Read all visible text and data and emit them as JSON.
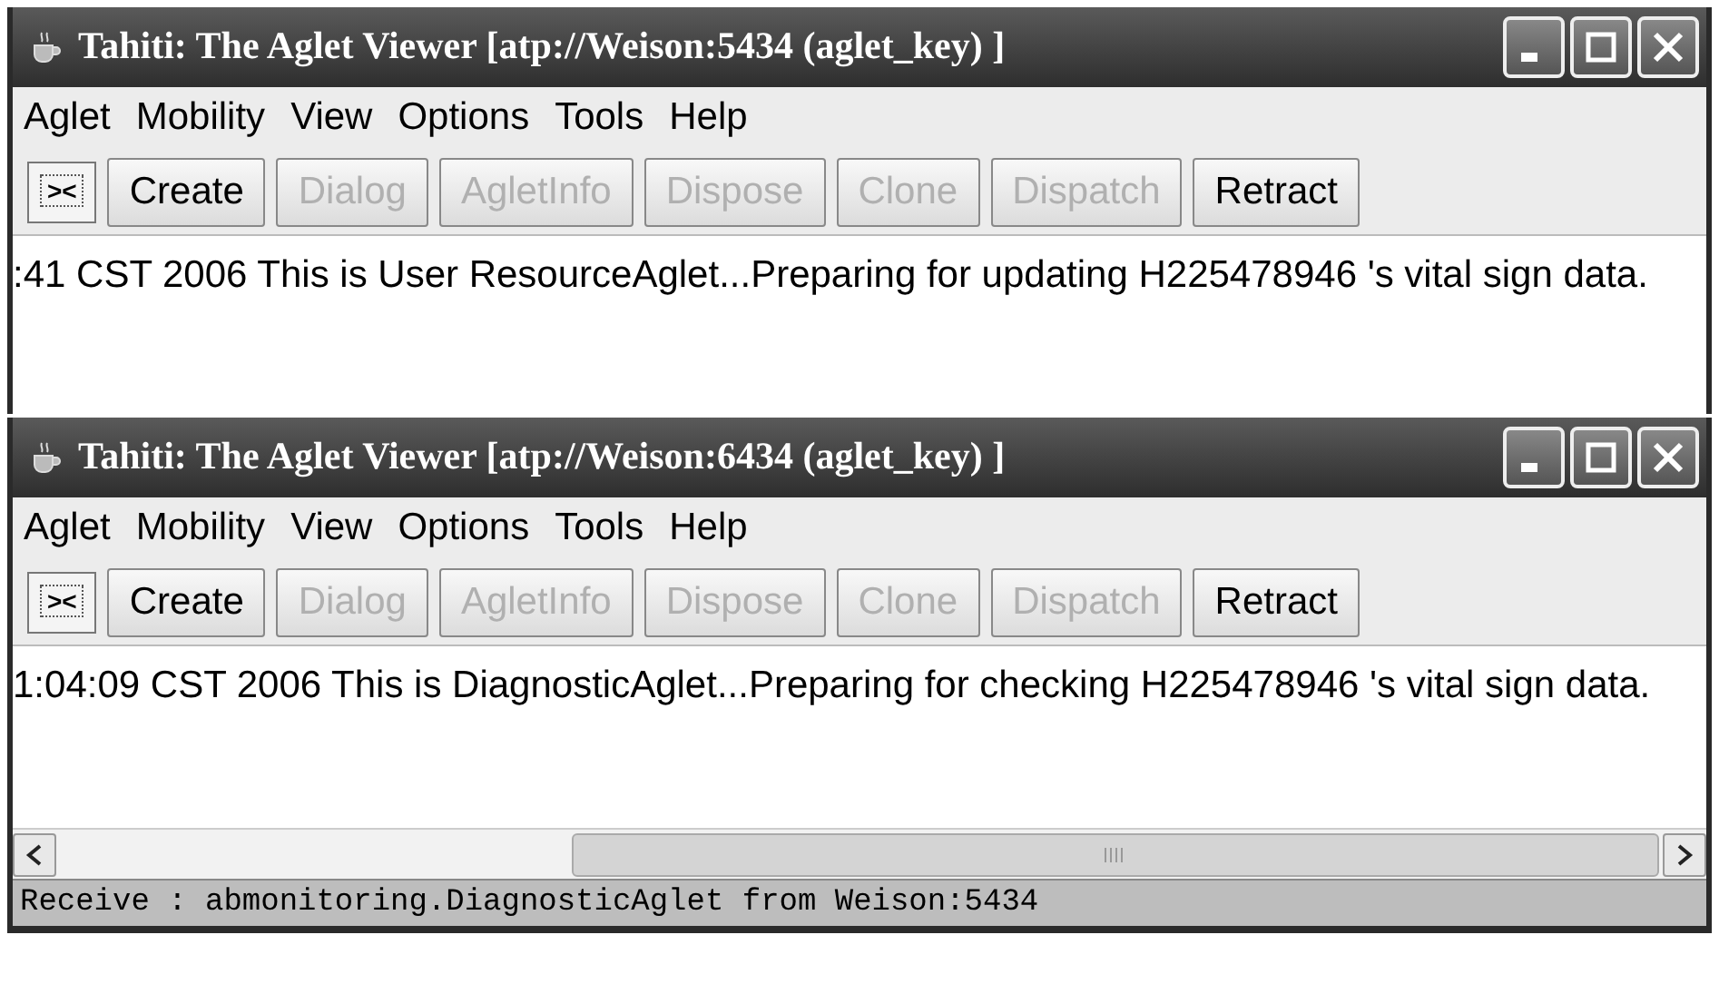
{
  "windows": [
    {
      "title": "Tahiti: The Aglet Viewer [atp://Weison:5434 (aglet_key) ]",
      "menu": [
        "Aglet",
        "Mobility",
        "View",
        "Options",
        "Tools",
        "Help"
      ],
      "toolbar": [
        {
          "label": "><",
          "kind": "toggle",
          "disabled": false
        },
        {
          "label": "Create",
          "kind": "button",
          "disabled": false
        },
        {
          "label": "Dialog",
          "kind": "button",
          "disabled": true
        },
        {
          "label": "AgletInfo",
          "kind": "button",
          "disabled": true
        },
        {
          "label": "Dispose",
          "kind": "button",
          "disabled": true
        },
        {
          "label": "Clone",
          "kind": "button",
          "disabled": true
        },
        {
          "label": "Dispatch",
          "kind": "button",
          "disabled": true
        },
        {
          "label": "Retract",
          "kind": "button",
          "disabled": false
        }
      ],
      "log": [
        ":41 CST 2006 This is User ResourceAglet...Preparing for updating H225478946 's vital sign data."
      ]
    },
    {
      "title": "Tahiti: The Aglet Viewer [atp://Weison:6434 (aglet_key) ]",
      "menu": [
        "Aglet",
        "Mobility",
        "View",
        "Options",
        "Tools",
        "Help"
      ],
      "toolbar": [
        {
          "label": "><",
          "kind": "toggle",
          "disabled": false
        },
        {
          "label": "Create",
          "kind": "button",
          "disabled": false
        },
        {
          "label": "Dialog",
          "kind": "button",
          "disabled": true
        },
        {
          "label": "AgletInfo",
          "kind": "button",
          "disabled": true
        },
        {
          "label": "Dispose",
          "kind": "button",
          "disabled": true
        },
        {
          "label": "Clone",
          "kind": "button",
          "disabled": true
        },
        {
          "label": "Dispatch",
          "kind": "button",
          "disabled": true
        },
        {
          "label": "Retract",
          "kind": "button",
          "disabled": false
        }
      ],
      "log": [
        "1:04:09 CST 2006 This is DiagnosticAglet...Preparing for checking H225478946 's vital sign data."
      ],
      "horizontal_scrollbar": true,
      "status_bar": "Receive : abmonitoring.DiagnosticAglet from Weison:5434"
    }
  ]
}
